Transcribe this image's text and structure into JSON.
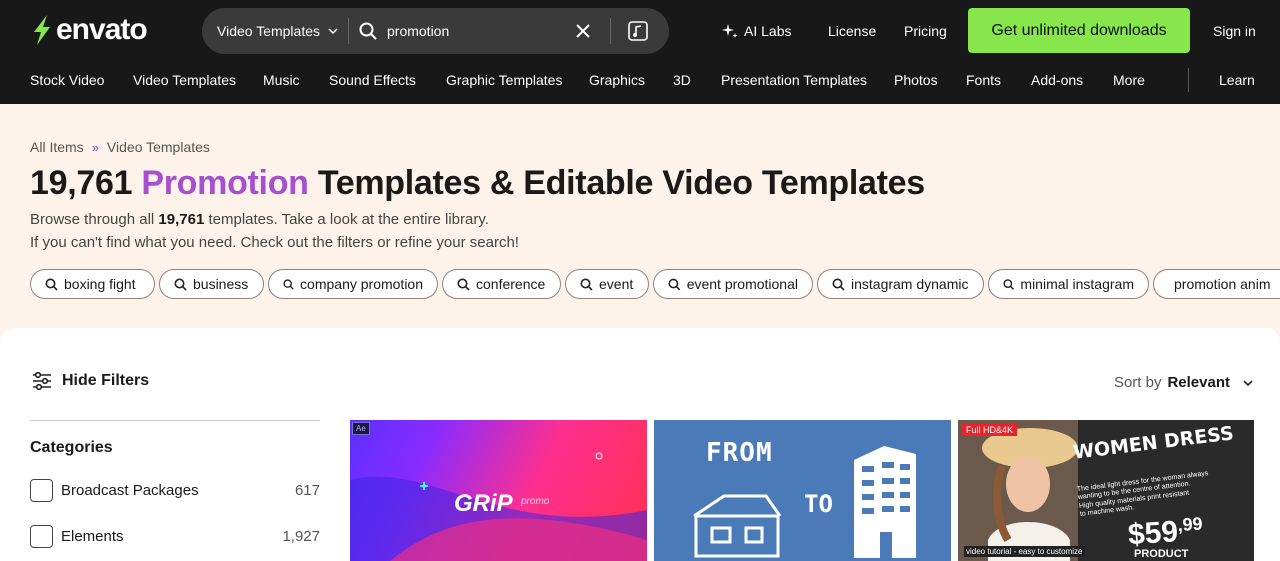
{
  "header": {
    "logo": "envato",
    "search": {
      "category": "Video Templates",
      "query": "promotion"
    },
    "nav": {
      "ai_labs": "AI Labs",
      "license": "License",
      "pricing": "Pricing",
      "cta": "Get unlimited downloads",
      "sign_in": "Sign in"
    },
    "categories": [
      "Stock Video",
      "Video Templates",
      "Music",
      "Sound Effects",
      "Graphic Templates",
      "Graphics",
      "3D",
      "Presentation Templates",
      "Photos",
      "Fonts",
      "Add-ons",
      "More",
      "Learn"
    ]
  },
  "breadcrumb": {
    "root": "All Items",
    "separator": "»",
    "current": "Video Templates"
  },
  "heading": {
    "count": "19,761",
    "keyword": "Promotion",
    "rest": "Templates & Editable Video Templates"
  },
  "description": {
    "line1_prefix": "Browse through all",
    "line1_count": "19,761",
    "line1_suffix": "templates. Take a look at the entire library.",
    "line2": "If you can't find what you need. Check out the filters or refine your search!"
  },
  "tags": [
    "boxing fight",
    "business",
    "company promotion",
    "conference",
    "event",
    "event promotional",
    "instagram dynamic",
    "minimal instagram",
    "promotion anim"
  ],
  "filters": {
    "toggle": "Hide Filters",
    "sort_prefix": "Sort by",
    "sort_value": "Relevant",
    "categories_title": "Categories",
    "categories": [
      {
        "label": "Broadcast Packages",
        "count": "617"
      },
      {
        "label": "Elements",
        "count": "1,927"
      }
    ]
  },
  "thumbnails": [
    {
      "badge": "Ae",
      "title": "GRiP",
      "subtitle": "promo"
    },
    {
      "from": "FROM",
      "to": "TO"
    },
    {
      "badge": "Full HD&4K",
      "title": "WOMEN DRESS",
      "lines": [
        "The ideal light dress for the woman always",
        "wanting to be the centre of attention.",
        "High quality materials print resistant",
        "to machine wash."
      ],
      "price": "$59",
      "cents": ",99",
      "note": "video tutorial - easy to customize",
      "footer": "PRODUCT PROMOTION"
    }
  ],
  "colors": {
    "header_bg": "#181818",
    "accent_purple": "#a64fd0",
    "cta_green": "#87e64b",
    "page_bg": "#fdf3ea"
  }
}
